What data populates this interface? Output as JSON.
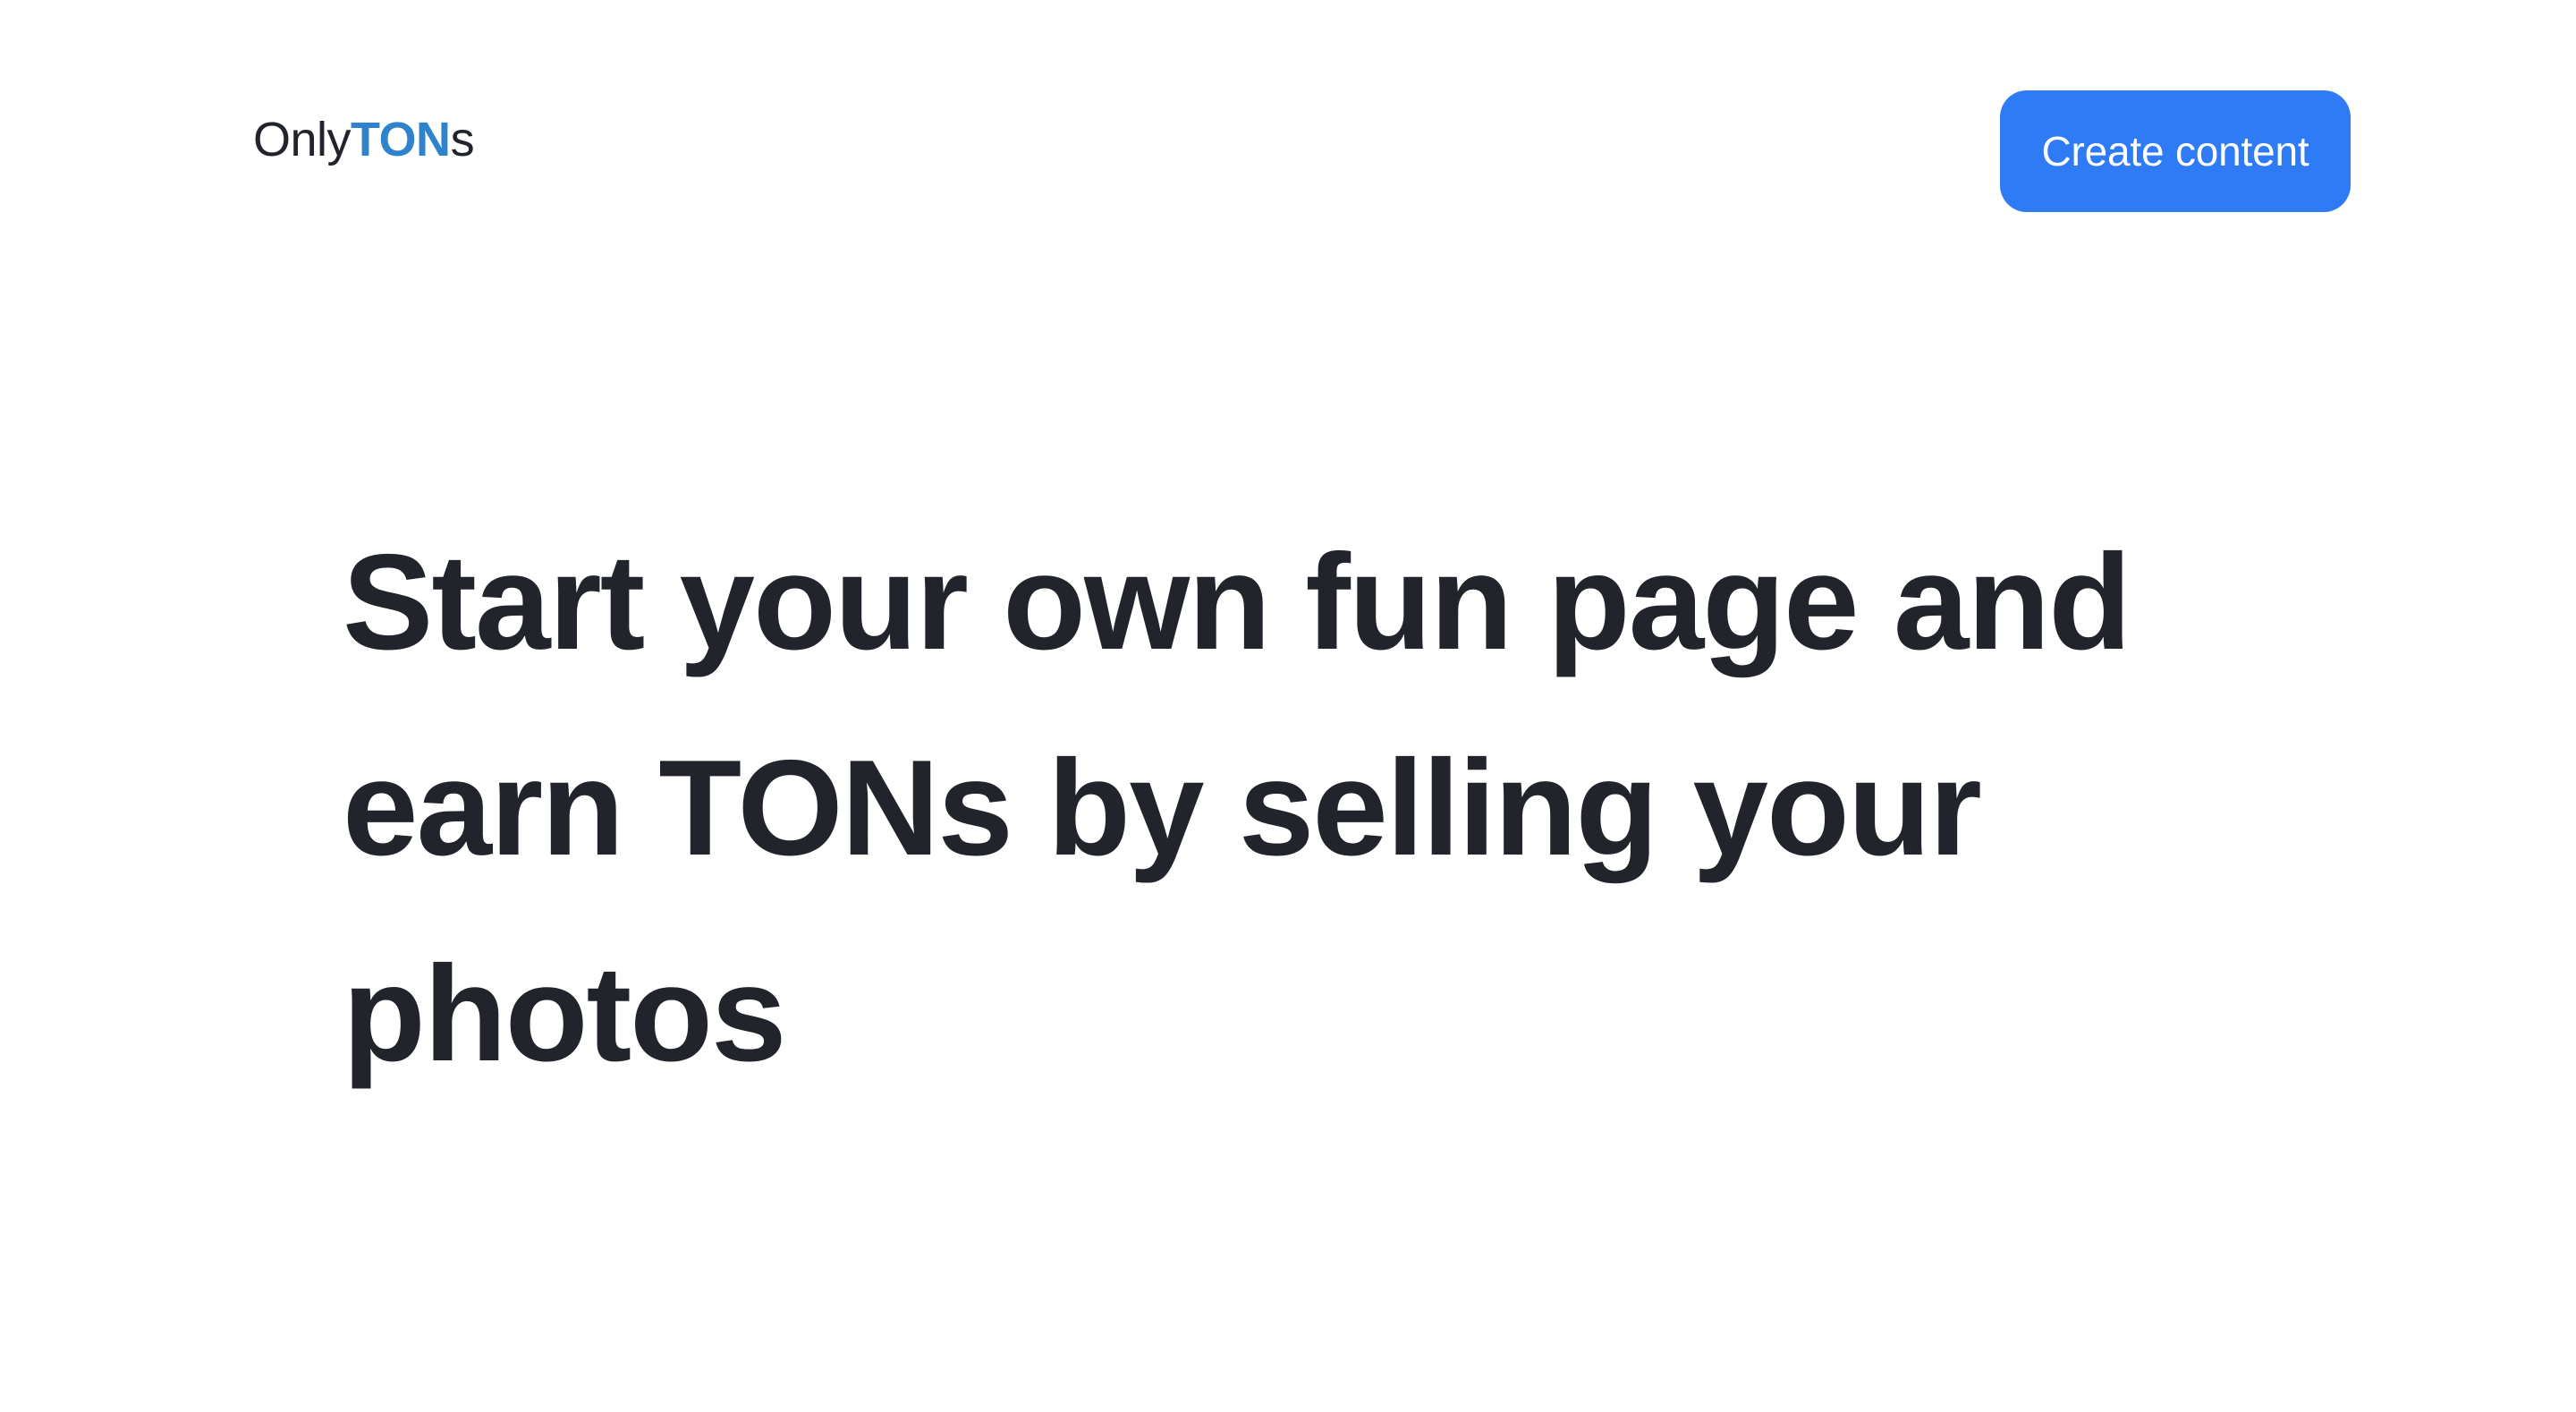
{
  "header": {
    "logo": {
      "prefix": "Only",
      "highlight": "TON",
      "suffix": "s"
    },
    "create_button_label": "Create content"
  },
  "hero": {
    "title": "Start your own fun page and earn TONs by selling your photos"
  },
  "colors": {
    "accent_logo": "#2f83cc",
    "button_background": "#2f7bf5",
    "text_primary": "#21242b",
    "page_background": "#ffffff"
  }
}
